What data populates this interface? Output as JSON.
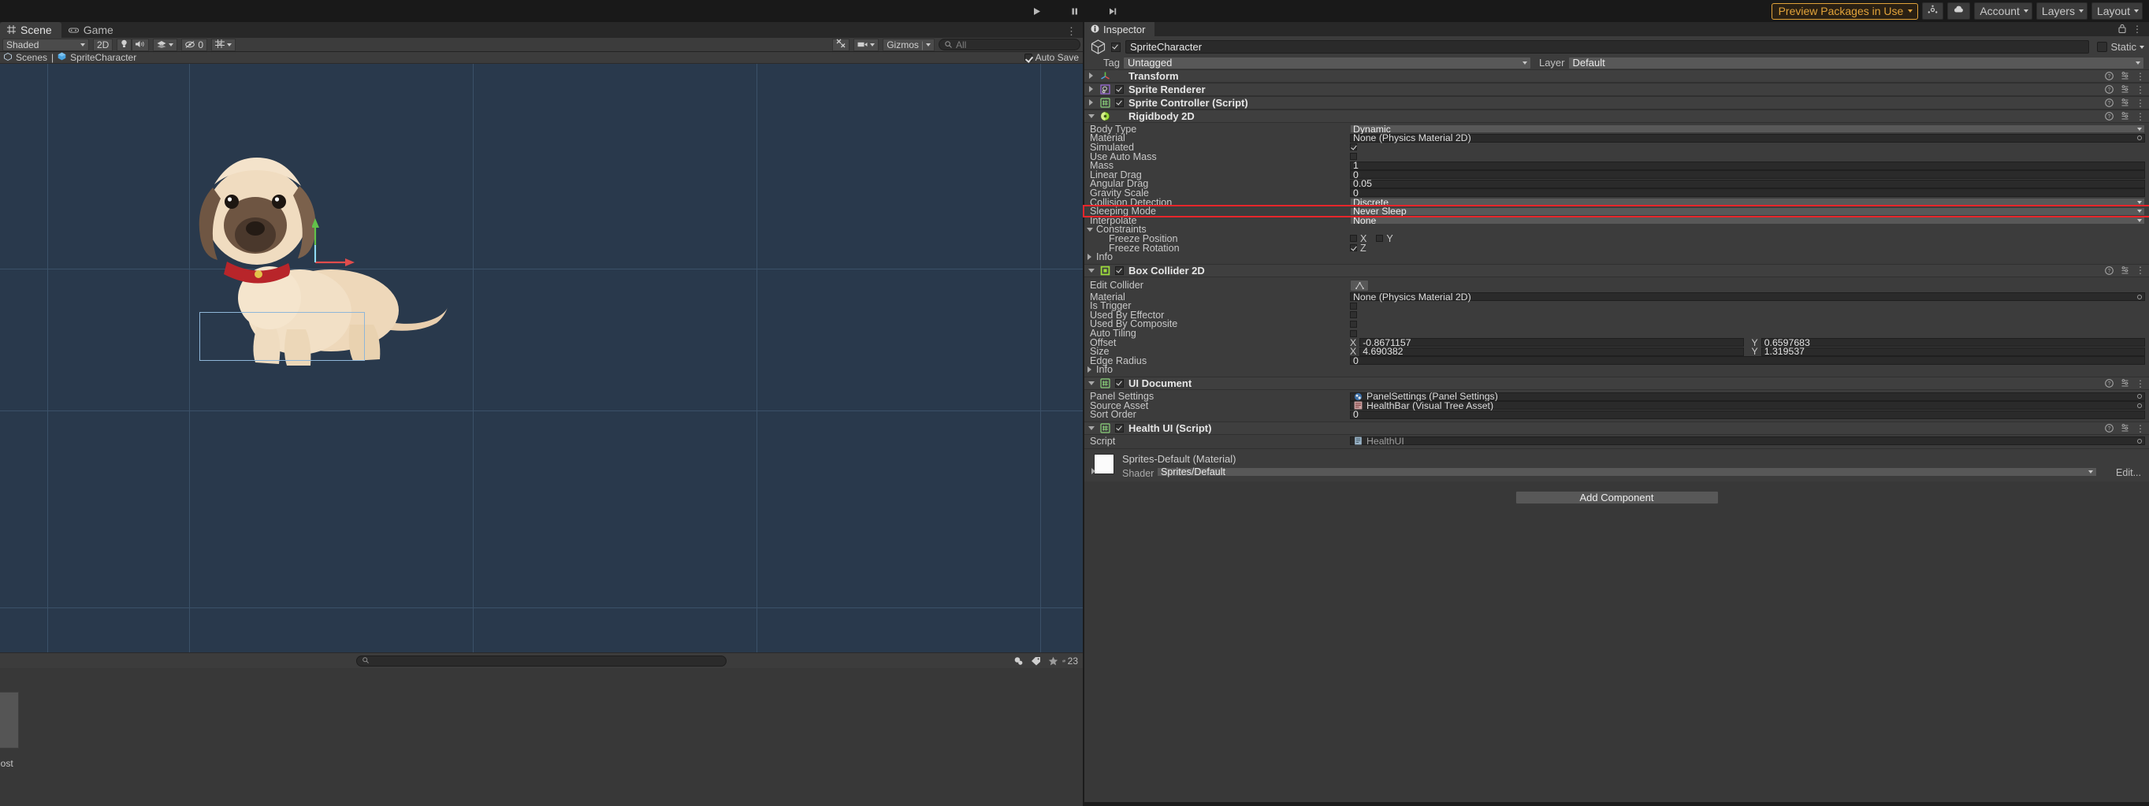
{
  "appbar": {
    "play_icon": "play-icon",
    "pause_icon": "pause-icon",
    "step_icon": "step-icon",
    "preview_packages_label": "Preview Packages in Use",
    "search_icon": "collab-icon",
    "cloud_icon": "cloud-icon",
    "account_label": "Account",
    "layers_label": "Layers",
    "layout_label": "Layout"
  },
  "scene": {
    "tabs": [
      {
        "label": "Scene",
        "icon": "grid-icon",
        "active": true
      },
      {
        "label": "Game",
        "icon": "gamepad-icon",
        "active": false
      }
    ],
    "toolbar": {
      "shading_mode": "Shaded",
      "mode_2d": "2D",
      "light_icon": "lightbulb-icon",
      "audio_icon": "speaker-icon",
      "fx_icon": "effects-icon",
      "hidden_icon": "eye-off-icon",
      "hidden_count": "0",
      "grid_icon": "grid-snap-icon",
      "tools_icon": "tools-icon",
      "camera_icon": "camera-icon",
      "gizmos_label": "Gizmos",
      "search_placeholder": "All",
      "search_icon": "search-icon"
    },
    "breadcrumb": {
      "scenes_label": "Scenes",
      "separator": "|",
      "object_label": "SpriteCharacter",
      "autosave_label": "Auto Save",
      "autosave_checked": true
    },
    "status": {
      "search_value": "",
      "search_icon": "search-icon",
      "icons": [
        "lighting-icon",
        "tag-icon",
        "favorite-icon",
        "eye-off-icon"
      ],
      "hidden_count": "23"
    },
    "lower": {
      "asset_label": "nPost"
    }
  },
  "inspector": {
    "tab_label": "Inspector",
    "tab_icon": "info-icon",
    "lock_icon": "lock-icon",
    "menu_icon": "kebab-icon",
    "gameobject": {
      "icon": "cube-icon",
      "enabled": true,
      "name": "SpriteCharacter",
      "static_label": "Static",
      "static_checked": false,
      "tag_label": "Tag",
      "tag_value": "Untagged",
      "layer_label": "Layer",
      "layer_value": "Default"
    },
    "components": [
      {
        "name": "Transform",
        "icon": "transform-icon",
        "expanded": false,
        "has_checkbox": false
      },
      {
        "name": "Sprite Renderer",
        "icon": "sprite-renderer-icon",
        "expanded": false,
        "has_checkbox": true,
        "enabled": true
      },
      {
        "name": "Sprite Controller (Script)",
        "icon": "script-icon",
        "expanded": false,
        "has_checkbox": true,
        "enabled": true
      },
      {
        "name": "Rigidbody 2D",
        "icon": "rigidbody2d-icon",
        "expanded": true,
        "has_checkbox": false,
        "properties": [
          {
            "label": "Body Type",
            "type": "dropdown",
            "value": "Dynamic"
          },
          {
            "label": "Material",
            "type": "object",
            "value": "None (Physics Material 2D)"
          },
          {
            "label": "Simulated",
            "type": "checkbox",
            "checked": true
          },
          {
            "label": "Use Auto Mass",
            "type": "checkbox",
            "checked": false
          },
          {
            "label": "Mass",
            "type": "number",
            "value": "1"
          },
          {
            "label": "Linear Drag",
            "type": "number",
            "value": "0"
          },
          {
            "label": "Angular Drag",
            "type": "number",
            "value": "0.05"
          },
          {
            "label": "Gravity Scale",
            "type": "number",
            "value": "0"
          },
          {
            "label": "Collision Detection",
            "type": "dropdown",
            "value": "Discrete"
          },
          {
            "label": "Sleeping Mode",
            "type": "dropdown",
            "value": "Never Sleep",
            "highlighted": true
          },
          {
            "label": "Interpolate",
            "type": "dropdown",
            "value": "None"
          },
          {
            "label": "Constraints",
            "type": "foldout",
            "expanded": true
          },
          {
            "label": "Freeze Position",
            "type": "axis2",
            "indent": 2,
            "axes": [
              {
                "name": "X",
                "checked": false
              },
              {
                "name": "Y",
                "checked": false
              }
            ]
          },
          {
            "label": "Freeze Rotation",
            "type": "axis1",
            "indent": 2,
            "axes": [
              {
                "name": "Z",
                "checked": true
              }
            ]
          },
          {
            "label": "Info",
            "type": "foldout",
            "expanded": false
          }
        ]
      },
      {
        "name": "Box Collider 2D",
        "icon": "boxcollider2d-icon",
        "expanded": true,
        "has_checkbox": true,
        "enabled": true,
        "properties": [
          {
            "label": "Edit Collider",
            "type": "editbutton",
            "icon": "edit-collider-icon"
          },
          {
            "label": "Material",
            "type": "object",
            "value": "None (Physics Material 2D)"
          },
          {
            "label": "Is Trigger",
            "type": "checkbox",
            "checked": false
          },
          {
            "label": "Used By Effector",
            "type": "checkbox",
            "checked": false
          },
          {
            "label": "Used By Composite",
            "type": "checkbox",
            "checked": false
          },
          {
            "label": "Auto Tiling",
            "type": "checkbox",
            "checked": false
          },
          {
            "label": "Offset",
            "type": "vector2",
            "x": "-0.8671157",
            "y": "0.6597683"
          },
          {
            "label": "Size",
            "type": "vector2",
            "x": "4.690382",
            "y": "1.319537"
          },
          {
            "label": "Edge Radius",
            "type": "number",
            "value": "0"
          },
          {
            "label": "Info",
            "type": "foldout",
            "expanded": false
          }
        ]
      },
      {
        "name": "UI Document",
        "icon": "script-icon",
        "expanded": true,
        "has_checkbox": true,
        "enabled": true,
        "properties": [
          {
            "label": "Panel Settings",
            "type": "object",
            "value": "PanelSettings (Panel Settings)",
            "icon": "panel-settings-icon"
          },
          {
            "label": "Source Asset",
            "type": "object",
            "value": "HealthBar (Visual Tree Asset)",
            "icon": "uxml-icon"
          },
          {
            "label": "Sort Order",
            "type": "number",
            "value": "0"
          }
        ]
      },
      {
        "name": "Health UI (Script)",
        "icon": "script-icon",
        "expanded": true,
        "has_checkbox": true,
        "enabled": true,
        "properties": [
          {
            "label": "Script",
            "type": "object-readonly",
            "value": "HealthUI",
            "icon": "script-file-icon"
          }
        ]
      }
    ],
    "material": {
      "title": "Sprites-Default (Material)",
      "shader_label": "Shader",
      "shader_value": "Sprites/Default",
      "edit_label": "Edit..."
    },
    "add_component_label": "Add Component"
  },
  "colors": {
    "accent_highlight": "#e8262b",
    "preview_orange": "#e2a33a",
    "panel_bg": "#383838",
    "viewport_bg": "#29394c",
    "selection_blue": "#8fb6d8"
  }
}
